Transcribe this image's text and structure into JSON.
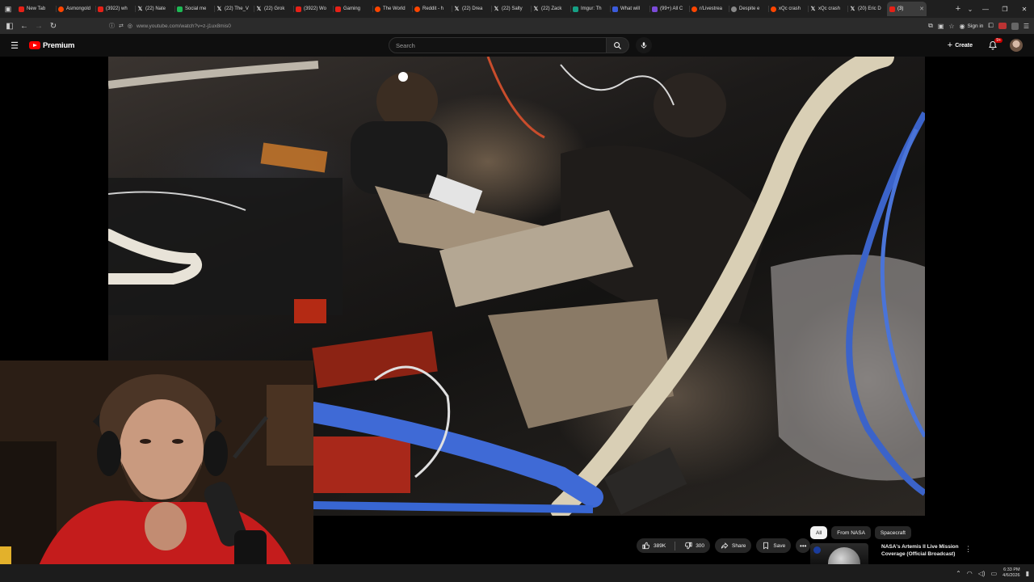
{
  "browser": {
    "tabs": [
      {
        "title": "New Tab",
        "icon": "youtube-icon",
        "active": false
      },
      {
        "title": "Asmongold",
        "icon": "reddit-icon",
        "active": false
      },
      {
        "title": "(3922) wh",
        "icon": "youtube-icon",
        "active": false
      },
      {
        "title": "(22) Nate",
        "icon": "x-icon",
        "active": false
      },
      {
        "title": "Social me",
        "icon": "green-icon",
        "active": false
      },
      {
        "title": "(22) The_V",
        "icon": "x-icon",
        "active": false
      },
      {
        "title": "(22) Grok",
        "icon": "x-icon",
        "active": false
      },
      {
        "title": "(3922) Wo",
        "icon": "youtube-icon",
        "active": false
      },
      {
        "title": "Gaming",
        "icon": "youtube-icon",
        "active": false
      },
      {
        "title": "The World",
        "icon": "reddit-icon",
        "active": false
      },
      {
        "title": "Reddit - h",
        "icon": "reddit-icon",
        "active": false
      },
      {
        "title": "(22) Drea",
        "icon": "x-icon",
        "active": false
      },
      {
        "title": "(22) Salty",
        "icon": "x-icon",
        "active": false
      },
      {
        "title": "(22) Zack",
        "icon": "x-icon",
        "active": false
      },
      {
        "title": "Imgur: Th",
        "icon": "imgur-icon",
        "active": false
      },
      {
        "title": "What will",
        "icon": "blue-icon",
        "active": false
      },
      {
        "title": "(99+) All C",
        "icon": "purple-icon",
        "active": false
      },
      {
        "title": "r/Livestrea",
        "icon": "reddit-icon",
        "active": false
      },
      {
        "title": "Despite e",
        "icon": "circle-icon",
        "active": false
      },
      {
        "title": "xQc crash",
        "icon": "reddit-icon",
        "active": false
      },
      {
        "title": "xQc crash",
        "icon": "x-icon",
        "active": false
      },
      {
        "title": "(20) Eric D",
        "icon": "x-icon",
        "active": false
      },
      {
        "title": "(3)",
        "icon": "youtube-icon",
        "active": true
      }
    ],
    "url": "www.youtube.com/watch?v=z-j1ux8mis0",
    "sign_in_label": "Sign in"
  },
  "youtube": {
    "logo_text": "Premium",
    "search_placeholder": "Search",
    "create_label": "Create",
    "notification_count": "9+"
  },
  "video_actions": {
    "likes": "389K",
    "dislikes": "300",
    "share_label": "Share",
    "save_label": "Save"
  },
  "chips": [
    "All",
    "From NASA",
    "Spacecraft"
  ],
  "related": {
    "title_line1": "NASA's Artemis II Live Mission",
    "title_line2": "Coverage (Official Broadcast)"
  },
  "taskbar": {
    "time": "6:33 PM",
    "date": "4/6/2026"
  },
  "colors": {
    "yt_red": "#ff0000",
    "background": "#0f0f0f",
    "pill": "#272727"
  }
}
